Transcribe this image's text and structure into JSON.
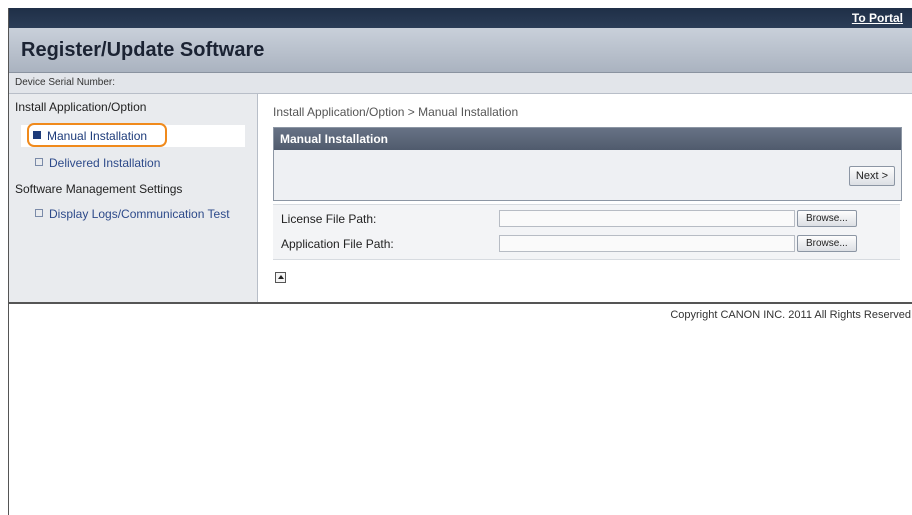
{
  "header": {
    "portal_link": "To Portal",
    "title": "Register/Update Software"
  },
  "serial": {
    "label": "Device Serial Number:"
  },
  "sidebar": {
    "groups": [
      {
        "label": "Install Application/Option",
        "items": [
          {
            "label": "Manual Installation",
            "active": true
          },
          {
            "label": "Delivered Installation",
            "active": false
          }
        ]
      },
      {
        "label": "Software Management Settings",
        "items": [
          {
            "label": "Display Logs/Communication Test",
            "active": false
          }
        ]
      }
    ]
  },
  "main": {
    "breadcrumb": "Install Application/Option > Manual Installation",
    "panel_title": "Manual Installation",
    "next_button": "Next >",
    "fields": [
      {
        "label": "License File Path:",
        "value": "",
        "button": "Browse..."
      },
      {
        "label": "Application File Path:",
        "value": "",
        "button": "Browse..."
      }
    ]
  },
  "footer": {
    "copyright": "Copyright CANON INC. 2011 All Rights Reserved"
  },
  "colors": {
    "highlight": "#f08a1c",
    "topbar": "#1f2f47",
    "panel_header": "#5a6578"
  }
}
